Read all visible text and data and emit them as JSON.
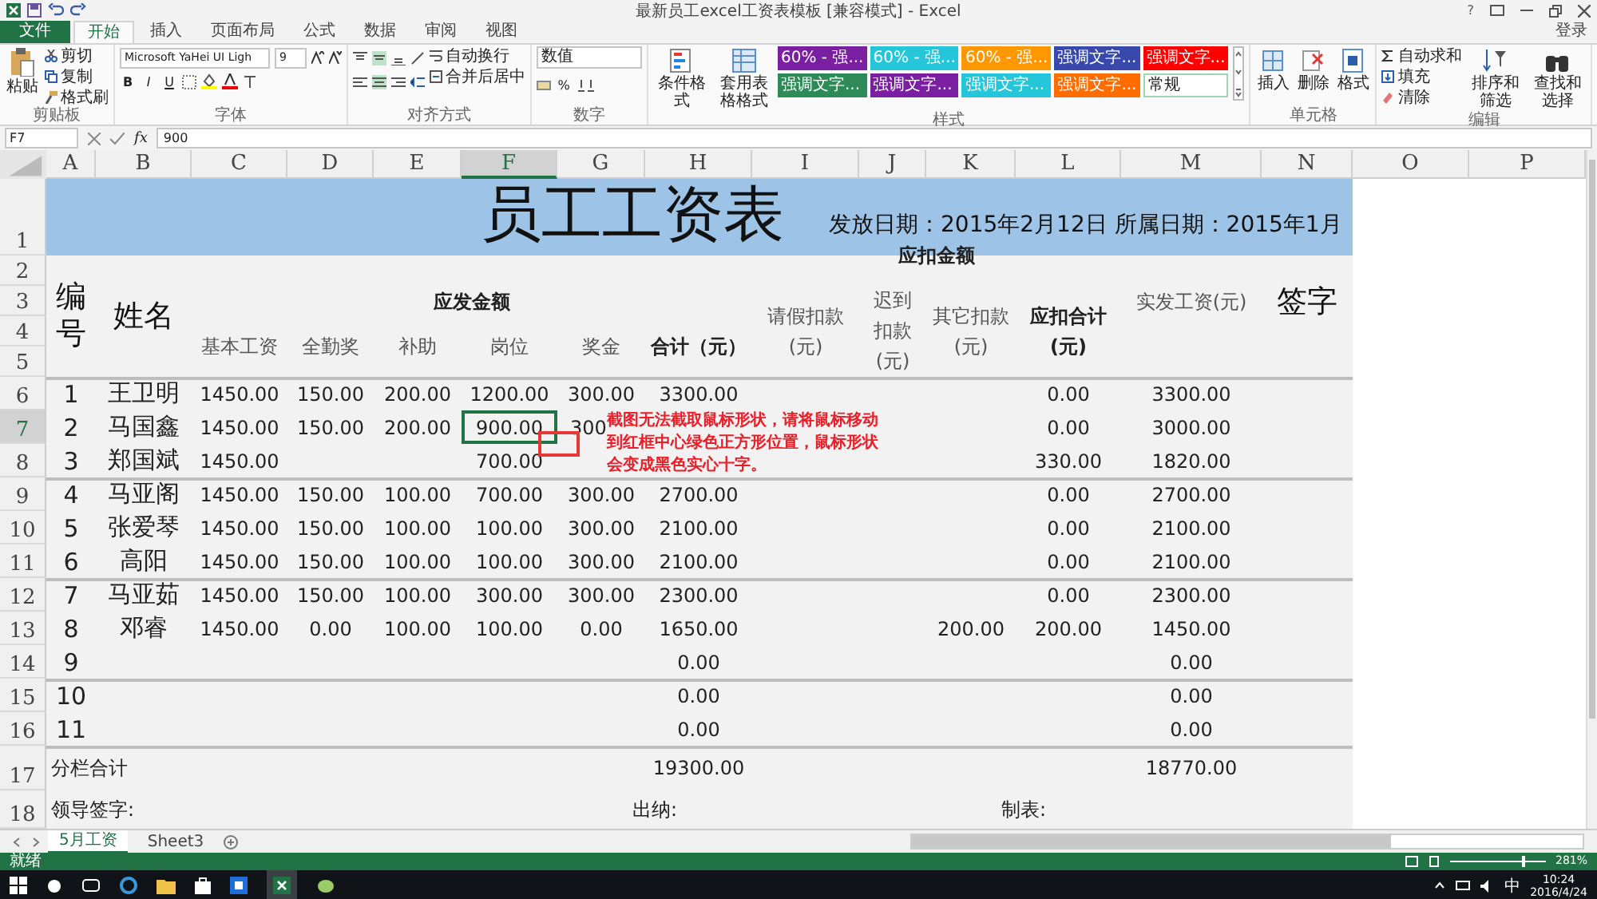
{
  "window": {
    "title": "最新员工excel工资表模板 [兼容模式] - Excel",
    "help": "?",
    "account": "登录"
  },
  "ribbon_tabs": [
    {
      "label": "文件",
      "kind": "file",
      "selected": false
    },
    {
      "label": "开始",
      "kind": "tab",
      "selected": true
    },
    {
      "label": "插入",
      "kind": "tab",
      "selected": false
    },
    {
      "label": "页面布局",
      "kind": "tab",
      "selected": false
    },
    {
      "label": "公式",
      "kind": "tab",
      "selected": false
    },
    {
      "label": "数据",
      "kind": "tab",
      "selected": false
    },
    {
      "label": "审阅",
      "kind": "tab",
      "selected": false
    },
    {
      "label": "视图",
      "kind": "tab",
      "selected": false
    }
  ],
  "ribbon": {
    "clipboard": {
      "paste": "粘贴",
      "cut": "剪切",
      "copy": "复制",
      "painter": "格式刷",
      "label": "剪贴板"
    },
    "font": {
      "name": "Microsoft YaHei UI Ligh",
      "size": "9",
      "bold": "B",
      "italic": "I",
      "underline": "U",
      "label": "字体"
    },
    "alignment": {
      "wrap": "自动换行",
      "merge": "合并后居中",
      "label": "对齐方式"
    },
    "number": {
      "format": "数值",
      "percent": "%",
      "label": "数字"
    },
    "styles": {
      "conditional": "条件格式",
      "table": "套用表格格式",
      "label": "样式",
      "chips": [
        {
          "label": "60% - 强...",
          "color": "#7b1fa2"
        },
        {
          "label": "60% - 强...",
          "color": "#26c6da"
        },
        {
          "label": "60% - 强...",
          "color": "#ff9800"
        },
        {
          "label": "强调文字...",
          "color": "#3949ab"
        },
        {
          "label": "强调文字...",
          "color": "#ff0000"
        },
        {
          "label": "强调文字...",
          "color": "#2e8b57"
        },
        {
          "label": "强调文字...",
          "color": "#7b1fa2"
        },
        {
          "label": "强调文字...",
          "color": "#26c6da"
        },
        {
          "label": "强调文字...",
          "color": "#ff6d00"
        },
        {
          "label": "常规",
          "color": "#ffffff"
        }
      ]
    },
    "cells": {
      "insert": "插入",
      "delete": "删除",
      "format": "格式",
      "label": "单元格"
    },
    "editing": {
      "autosum": "自动求和",
      "fill": "填充",
      "clear": "清除",
      "sort": "排序和筛选",
      "find": "查找和选择",
      "label": "编辑"
    }
  },
  "formula_bar": {
    "name_box": "F7",
    "fx": "fx",
    "value": "900"
  },
  "columns": [
    {
      "label": "A",
      "selected": false
    },
    {
      "label": "B",
      "selected": false
    },
    {
      "label": "C",
      "selected": false
    },
    {
      "label": "D",
      "selected": false
    },
    {
      "label": "E",
      "selected": false
    },
    {
      "label": "F",
      "selected": true
    },
    {
      "label": "G",
      "selected": false
    },
    {
      "label": "H",
      "selected": false
    },
    {
      "label": "I",
      "selected": false
    },
    {
      "label": "J",
      "selected": false
    },
    {
      "label": "K",
      "selected": false
    },
    {
      "label": "L",
      "selected": false
    },
    {
      "label": "M",
      "selected": false
    },
    {
      "label": "N",
      "selected": false
    },
    {
      "label": "O",
      "selected": false
    },
    {
      "label": "P",
      "selected": false
    }
  ],
  "sheet": {
    "title": "员工工资表",
    "dates": "发放日期：2015年2月12日 所属日期：2015年1月",
    "header_row_numbers": [
      "1",
      "2",
      "3",
      "4",
      "5"
    ],
    "header": {
      "number": "编号",
      "name": "姓名",
      "payable": "应发金额",
      "deductions": "应扣金额",
      "net": "实发工资(元)",
      "signature": "签字",
      "payable_columns": [
        "基本工资",
        "全勤奖",
        "补助",
        "岗位",
        "奖金",
        "合计（元）"
      ],
      "deduction_columns": [
        "请假扣款(元)",
        "迟到扣款(元)",
        "其它扣款(元)",
        "应扣合计(元)"
      ]
    },
    "rows": [
      {
        "row_number": "6",
        "number": "1",
        "name": "王卫明",
        "group_start": true,
        "active": false,
        "cells": {
          "base": "1450.00",
          "attendance": "150.00",
          "subsidy": "200.00",
          "post": "1200.00",
          "bonus": "300.00",
          "total": "3300.00",
          "deduction_total": "0.00",
          "net": "3300.00"
        }
      },
      {
        "row_number": "7",
        "number": "2",
        "name": "马国鑫",
        "group_start": false,
        "active": true,
        "cells": {
          "base": "1450.00",
          "attendance": "150.00",
          "subsidy": "200.00",
          "post": "900.00",
          "bonus": "300",
          "deduction_total": "0.00",
          "net": "3000.00"
        }
      },
      {
        "row_number": "8",
        "number": "3",
        "name": "郑国斌",
        "group_start": false,
        "active": false,
        "cells": {
          "base": "1450.00",
          "post": "700.00",
          "deduction_total": "330.00",
          "net": "1820.00"
        }
      },
      {
        "row_number": "9",
        "number": "4",
        "name": "马亚阁",
        "group_start": true,
        "active": false,
        "cells": {
          "base": "1450.00",
          "attendance": "150.00",
          "subsidy": "100.00",
          "post": "700.00",
          "bonus": "300.00",
          "total": "2700.00",
          "deduction_total": "0.00",
          "net": "2700.00"
        }
      },
      {
        "row_number": "10",
        "number": "5",
        "name": "张爱琴",
        "group_start": false,
        "active": false,
        "cells": {
          "base": "1450.00",
          "attendance": "150.00",
          "subsidy": "100.00",
          "post": "100.00",
          "bonus": "300.00",
          "total": "2100.00",
          "deduction_total": "0.00",
          "net": "2100.00"
        }
      },
      {
        "row_number": "11",
        "number": "6",
        "name": "高阳",
        "group_start": false,
        "active": false,
        "cells": {
          "base": "1450.00",
          "attendance": "150.00",
          "subsidy": "100.00",
          "post": "100.00",
          "bonus": "300.00",
          "total": "2100.00",
          "deduction_total": "0.00",
          "net": "2100.00"
        }
      },
      {
        "row_number": "12",
        "number": "7",
        "name": "马亚茹",
        "group_start": true,
        "active": false,
        "cells": {
          "base": "1450.00",
          "attendance": "150.00",
          "subsidy": "100.00",
          "post": "300.00",
          "bonus": "300.00",
          "total": "2300.00",
          "deduction_total": "0.00",
          "net": "2300.00"
        }
      },
      {
        "row_number": "13",
        "number": "8",
        "name": "邓睿",
        "group_start": false,
        "active": false,
        "cells": {
          "base": "1450.00",
          "attendance": "0.00",
          "subsidy": "100.00",
          "post": "100.00",
          "bonus": "0.00",
          "total": "1650.00",
          "other": "200.00",
          "deduction_total": "200.00",
          "net": "1450.00"
        }
      },
      {
        "row_number": "14",
        "number": "9",
        "group_start": false,
        "active": false,
        "cells": {
          "total": "0.00",
          "net": "0.00"
        }
      },
      {
        "row_number": "15",
        "number": "10",
        "group_start": true,
        "active": false,
        "cells": {
          "total": "0.00",
          "net": "0.00"
        }
      },
      {
        "row_number": "16",
        "number": "11",
        "group_start": false,
        "active": false,
        "cells": {
          "total": "0.00",
          "net": "0.00"
        }
      }
    ],
    "totals": {
      "row_number": "17",
      "label": "分栏合计",
      "total": "19300.00",
      "net": "18770.00"
    },
    "signoff": {
      "row_number": "18",
      "leader": "领导签字:",
      "cashier": "出纳:",
      "preparer": "制表:"
    },
    "annotation": "截图无法截取鼠标形状，请将鼠标移动到红框中心绿色正方形位置，鼠标形状会变成黑色实心十字。"
  },
  "sheet_tabs": [
    {
      "label": "5月工资",
      "selected": true
    },
    {
      "label": "Sheet3",
      "selected": false
    }
  ],
  "status_bar": {
    "mode": "就绪",
    "zoom": "281%",
    "level": 0.75
  },
  "taskbar": {
    "ime": "中",
    "time": "10:24",
    "date": "2016/4/24"
  }
}
